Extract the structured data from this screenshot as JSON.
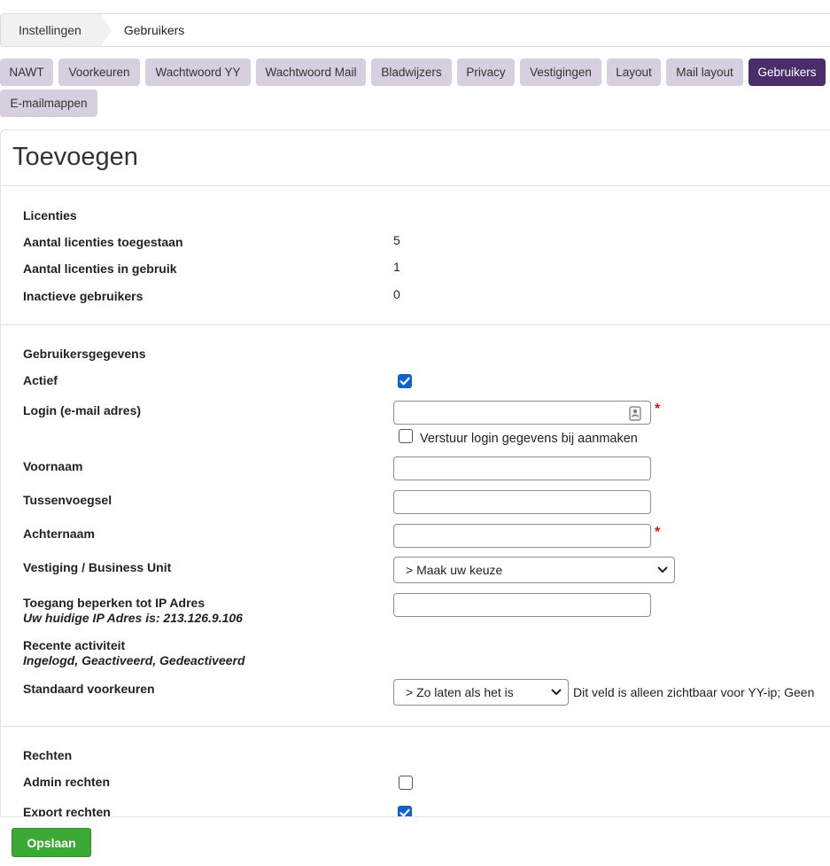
{
  "breadcrumb": {
    "first": "Instellingen",
    "second": "Gebruikers"
  },
  "tabs": [
    {
      "label": "NAWT"
    },
    {
      "label": "Voorkeuren"
    },
    {
      "label": "Wachtwoord YY"
    },
    {
      "label": "Wachtwoord Mail"
    },
    {
      "label": "Bladwijzers"
    },
    {
      "label": "Privacy"
    },
    {
      "label": "Vestigingen"
    },
    {
      "label": "Layout"
    },
    {
      "label": "Mail layout"
    },
    {
      "label": "Gebruikers",
      "active": true
    },
    {
      "label": "E-mailmappen"
    }
  ],
  "page": {
    "title": "Toevoegen"
  },
  "licenses": {
    "heading": "Licenties",
    "rows": [
      {
        "label": "Aantal licenties toegestaan",
        "value": "5"
      },
      {
        "label": "Aantal licenties in gebruik",
        "value": "1"
      },
      {
        "label": "Inactieve gebruikers",
        "value": "0"
      }
    ]
  },
  "user": {
    "heading": "Gebruikersgegevens",
    "active_label": "Actief",
    "active_checked": true,
    "login_label": "Login (e-mail adres)",
    "login_value": "",
    "send_login_label": "Verstuur login gegevens bij aanmaken",
    "send_login_checked": false,
    "firstname_label": "Voornaam",
    "firstname_value": "",
    "infix_label": "Tussenvoegsel",
    "infix_value": "",
    "lastname_label": "Achternaam",
    "lastname_value": "",
    "branch_label": "Vestiging / Business Unit",
    "branch_value": "> Maak uw keuze",
    "ip_label": "Toegang beperken tot IP Adres",
    "ip_note": "Uw huidige IP Adres is: 213.126.9.106",
    "ip_value": "",
    "activity_label": "Recente activiteit",
    "activity_note": "Ingelogd, Geactiveerd, Gedeactiveerd",
    "prefs_label": "Standaard voorkeuren",
    "prefs_value": "> Zo laten als het is",
    "prefs_note": "Dit veld is alleen zichtbaar voor YY-ip; Geen"
  },
  "rights": {
    "heading": "Rechten",
    "admin_label": "Admin rechten",
    "admin_checked": false,
    "export_label": "Export rechten",
    "export_checked": true
  },
  "actions": {
    "save_label": "Opslaan"
  },
  "colors": {
    "tab_bg": "#d6cfdf",
    "tab_active_bg": "#4a2d6b",
    "save_bg": "#3aaa35",
    "checkbox_blue": "#0b63ce",
    "required": "#dd1111"
  }
}
